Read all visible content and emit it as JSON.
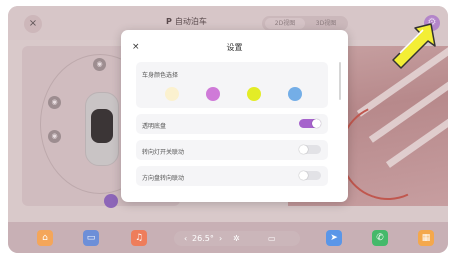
{
  "topbar": {
    "close_label": "×",
    "title_prefix": "P",
    "title": "自动泊车",
    "view_modes": [
      "2D视图",
      "3D视图"
    ],
    "settings_icon": "gear-icon"
  },
  "parking_view": {
    "side_icons": [
      "front-camera-icon",
      "side-camera-icon",
      "rear-camera-icon"
    ]
  },
  "settings_modal": {
    "close_label": "×",
    "title": "设置",
    "body_color": {
      "label": "车身颜色选择",
      "swatches": [
        "#fbf1cf",
        "#cf7ad8",
        "#e3ec26",
        "#74aee7"
      ]
    },
    "transparent_chassis": {
      "label": "透明底盘",
      "enabled": true
    },
    "turn_signal_link": {
      "label": "转向灯开关联动",
      "enabled": false
    },
    "steering_link": {
      "label": "方向盘转向联动",
      "enabled": false
    },
    "accent_color": "#a663cc"
  },
  "dock": {
    "apps": [
      {
        "icon": "home-icon",
        "color": "#f4a65a"
      },
      {
        "icon": "car-icon",
        "color": "#6d8fd8"
      },
      {
        "icon": "music-icon",
        "color": "#ee7d5b"
      },
      {
        "icon": "navigation-icon",
        "color": "#5a96e8"
      },
      {
        "icon": "phone-icon",
        "color": "#45b96a"
      },
      {
        "icon": "apps-grid-icon",
        "color": "#f4a84c"
      }
    ],
    "climate": {
      "left_arrow": "‹",
      "temperature": "26.5°",
      "right_arrow": "›",
      "fan_icon": "fan-icon",
      "defrost_icon": "defrost-icon"
    }
  },
  "annotation": {
    "pointer": "arrow-pointer-icon",
    "color": "#f3ee35"
  }
}
